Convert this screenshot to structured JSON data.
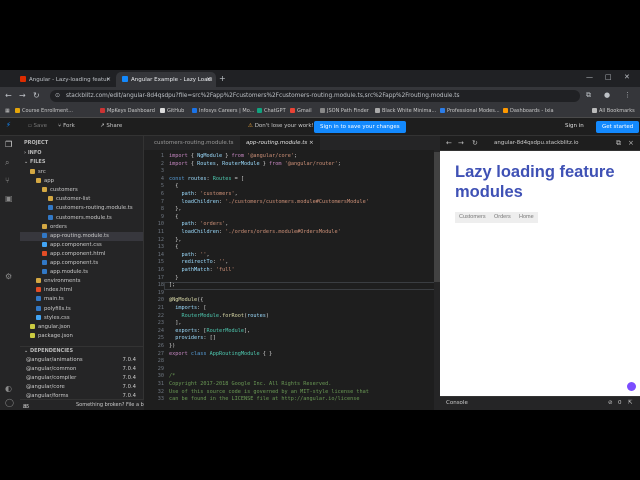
{
  "browser": {
    "tabs": [
      {
        "title": "Angular - Lazy-loading featur",
        "color": "#dd2c00"
      },
      {
        "title": "Angular Example - Lazy Loadi",
        "color": "#1389fd"
      }
    ],
    "url": "stackblitz.com/edit/angular-8d4qsdpu?file=src%2Fapp%2Fcustomers%2Fcustomers-routing.module.ts,src%2Fapp%2Frouting.module.ts",
    "bookmarks": [
      "Course Enrollment...",
      "MpKeys Dashboard",
      "GitHub",
      "Infosys Careers | Mo...",
      "ChatGPT",
      "Gmail",
      "JSON Path Finder",
      "Black White Minima...",
      "Professional Modes...",
      "Dashboards - Ixia"
    ],
    "all_bookmarks": "All Bookmarks"
  },
  "toolbar": {
    "save": "Save",
    "fork": "Fork",
    "share": "Share",
    "warning": "Don't lose your work!",
    "signin_save": "Sign in to save your changes",
    "signin": "Sign in",
    "get_started": "Get started"
  },
  "explorer": {
    "project": "PROJECT",
    "info": "INFO",
    "files": "FILES",
    "tree": [
      {
        "name": "src",
        "indent": 1,
        "type": "folder"
      },
      {
        "name": "app",
        "indent": 2,
        "type": "folder"
      },
      {
        "name": "customers",
        "indent": 3,
        "type": "folder"
      },
      {
        "name": "customer-list",
        "indent": 4,
        "type": "folder"
      },
      {
        "name": "customers-routing.module.ts",
        "indent": 4,
        "type": "ts"
      },
      {
        "name": "customers.module.ts",
        "indent": 4,
        "type": "ts"
      },
      {
        "name": "orders",
        "indent": 3,
        "type": "folder"
      },
      {
        "name": "app-routing.module.ts",
        "indent": 3,
        "type": "ts",
        "selected": true
      },
      {
        "name": "app.component.css",
        "indent": 3,
        "type": "css"
      },
      {
        "name": "app.component.html",
        "indent": 3,
        "type": "html"
      },
      {
        "name": "app.component.ts",
        "indent": 3,
        "type": "ts"
      },
      {
        "name": "app.module.ts",
        "indent": 3,
        "type": "ts"
      },
      {
        "name": "environments",
        "indent": 2,
        "type": "folder"
      },
      {
        "name": "index.html",
        "indent": 2,
        "type": "html"
      },
      {
        "name": "main.ts",
        "indent": 2,
        "type": "ts"
      },
      {
        "name": "polyfills.ts",
        "indent": 2,
        "type": "ts"
      },
      {
        "name": "styles.css",
        "indent": 2,
        "type": "css"
      },
      {
        "name": "angular.json",
        "indent": 1,
        "type": "json"
      },
      {
        "name": "package.json",
        "indent": 1,
        "type": "json"
      }
    ],
    "dependencies": "DEPENDENCIES",
    "deps": [
      {
        "name": "@angular/animations",
        "version": "7.0.4"
      },
      {
        "name": "@angular/common",
        "version": "7.0.4"
      },
      {
        "name": "@angular/compiler",
        "version": "7.0.4"
      },
      {
        "name": "@angular/core",
        "version": "7.0.4"
      },
      {
        "name": "@angular/forms",
        "version": "7.0.4"
      }
    ],
    "status_count": "85",
    "status_msg": "Something broken? File a bug!"
  },
  "editor": {
    "tabs": [
      "customers-routing.module.ts",
      "app-routing.module.ts"
    ],
    "active_tab": 1
  },
  "preview": {
    "url": "angular-8d4qsdpu.stackblitz.io",
    "title": "Lazy loading feature modules",
    "links": [
      "Customers",
      "Orders",
      "Home"
    ],
    "console": "Console"
  }
}
